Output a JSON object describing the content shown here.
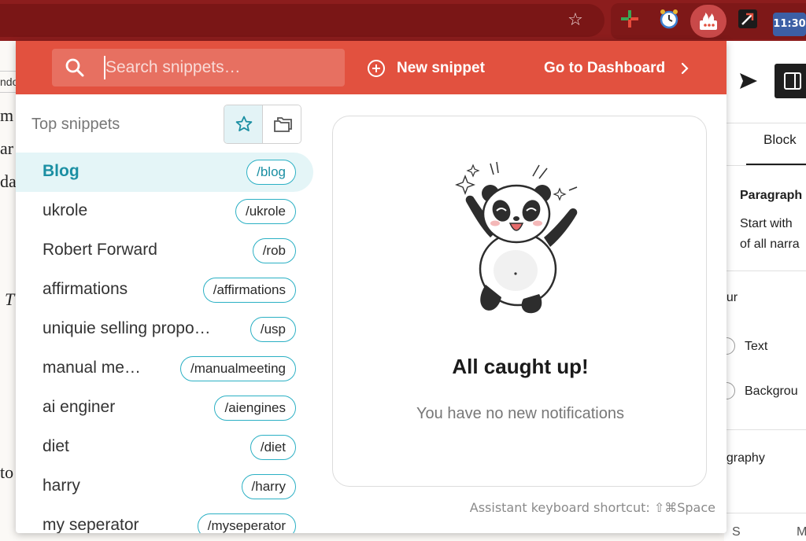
{
  "browser": {
    "extensions": [
      "tracker-ext-icon",
      "alarm-clock-ext-icon",
      "text-blaze-ext-icon",
      "arrow-ext-icon",
      "clock-ext-icon"
    ],
    "clock_badge": "11:30"
  },
  "background_page": {
    "left_tab_fragment": "ndo",
    "left_text_fragments": [
      "m",
      "ar",
      "da",
      "T",
      "to"
    ],
    "right": {
      "tab_partial": "t",
      "tab_block": "Block",
      "block_title": "Paragraph",
      "block_desc_line1": "Start with",
      "block_desc_line2": "of all narra",
      "section_colour": "our",
      "color_text": "Text",
      "color_background": "Backgrou",
      "section_typography": "ography",
      "bottom_s": "S",
      "bottom_m": "M"
    }
  },
  "header": {
    "search_placeholder": "Search snippets…",
    "new_snippet": "New snippet",
    "go_dashboard": "Go to Dashboard"
  },
  "sidebar": {
    "title": "Top snippets",
    "snippets": [
      {
        "name": "Blog",
        "shortcut": "/blog",
        "active": true
      },
      {
        "name": "ukrole",
        "shortcut": "/ukrole"
      },
      {
        "name": "Robert Forward",
        "shortcut": "/rob"
      },
      {
        "name": "affirmations",
        "shortcut": "/affirmations"
      },
      {
        "name": "uniquie selling propo…",
        "shortcut": "/usp"
      },
      {
        "name": "manual me…",
        "shortcut": "/manualmeeting"
      },
      {
        "name": "ai enginer",
        "shortcut": "/aiengines"
      },
      {
        "name": "diet",
        "shortcut": "/diet"
      },
      {
        "name": "harry",
        "shortcut": "/harry"
      },
      {
        "name": "my seperator",
        "shortcut": "/myseperator"
      }
    ]
  },
  "notifications": {
    "title": "All caught up!",
    "subtitle": "You have no new notifications"
  },
  "footer": {
    "shortcut_text": "Assistant keyboard shortcut: ⇧⌘Space"
  },
  "colors": {
    "brand_red": "#e2513f",
    "accent_teal": "#2bb0c4",
    "active_bg": "#e4f5f7"
  }
}
